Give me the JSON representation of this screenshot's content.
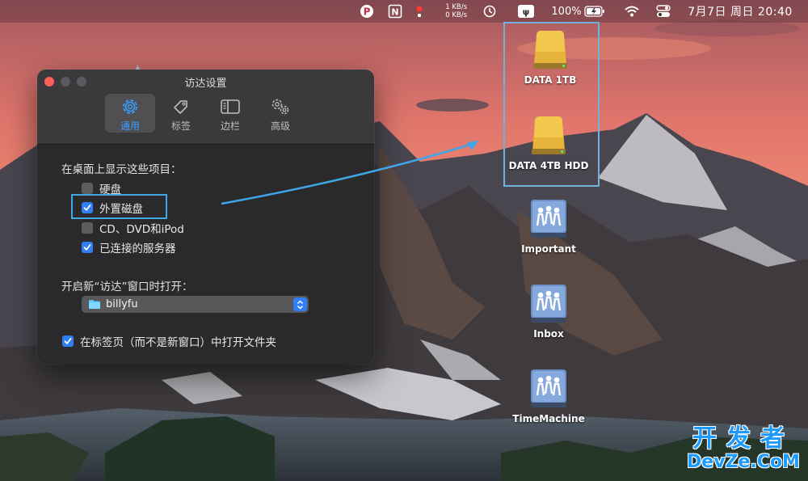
{
  "menubar": {
    "icons": [
      "pinterest-icon",
      "notion-icon",
      "record-dot-icon",
      "history-icon",
      "input-method-icon",
      "wifi-icon",
      "control-center-icon"
    ],
    "net_up": "1 KB/s",
    "net_down": "0 KB/s",
    "battery_percent": "100%",
    "clock": "7月7日 周日  20:40"
  },
  "window": {
    "title": "访达设置",
    "tabs": [
      {
        "label": "通用",
        "icon": "gear-icon",
        "active": true
      },
      {
        "label": "标签",
        "icon": "tag-icon",
        "active": false
      },
      {
        "label": "边栏",
        "icon": "sidebar-icon",
        "active": false
      },
      {
        "label": "高级",
        "icon": "gears-icon",
        "active": false
      }
    ],
    "show_items_label": "在桌面上显示这些项目：",
    "items": [
      {
        "label": "硬盘",
        "checked": false
      },
      {
        "label": "外置磁盘",
        "checked": true
      },
      {
        "label": "CD、DVD和iPod",
        "checked": false
      },
      {
        "label": "已连接的服务器",
        "checked": true
      }
    ],
    "new_window_label": "开启新“访达”窗口时打开：",
    "new_window_value": "billyfu",
    "tabs_option_label": "在标签页（而不是新窗口）中打开文件夹",
    "tabs_option_checked": true
  },
  "desktop": {
    "icons": [
      {
        "label": "DATA 1TB",
        "kind": "external-drive-icon"
      },
      {
        "label": "DATA 4TB HDD",
        "kind": "external-drive-icon"
      },
      {
        "label": "Important",
        "kind": "server-share-icon"
      },
      {
        "label": "Inbox",
        "kind": "server-share-icon"
      },
      {
        "label": "TimeMachine",
        "kind": "server-share-icon"
      }
    ]
  },
  "watermark": {
    "top": "开发者",
    "bottom": "DevZe.CoM"
  },
  "colors": {
    "accent": "#2f7ff6",
    "highlight": "#3fa7e8",
    "window_bg": "#2a2a2c",
    "close_button": "#fe5f57"
  }
}
